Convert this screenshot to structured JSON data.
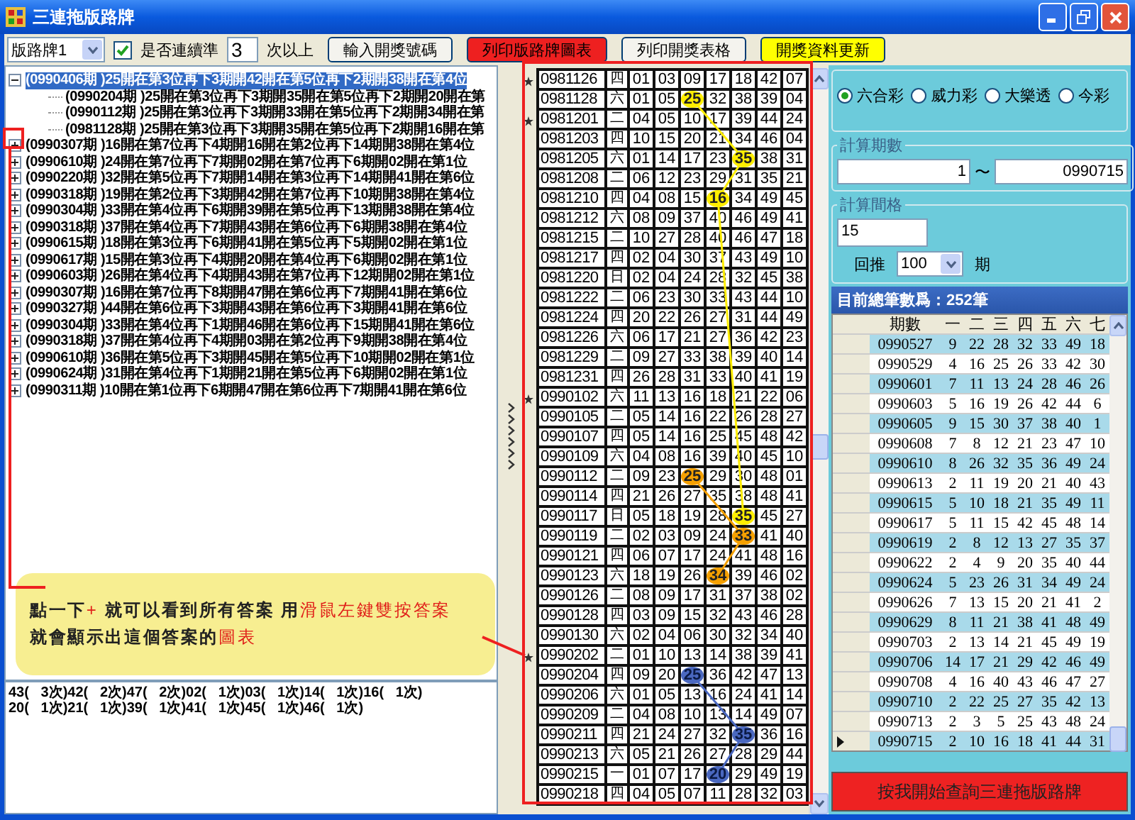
{
  "window": {
    "title": "三連拖版路牌"
  },
  "toolbar": {
    "board_select": {
      "value": "版路牌1"
    },
    "consecutive": {
      "label": "是否連續準",
      "checked": true
    },
    "count_field": {
      "value": "3"
    },
    "count_suffix": "次以上",
    "buttons": [
      {
        "label": "輸入開獎號碼",
        "color": "#f4f3ee"
      },
      {
        "label": "列印版路牌圖表",
        "color": "#ee2020"
      },
      {
        "label": "列印開獎表格",
        "color": "#f4f3ee"
      },
      {
        "label": "開獎資料更新",
        "color": "#ffff00"
      }
    ]
  },
  "tree": [
    {
      "label": "(0990406期 )25開在第3位再下3期開42開在第5位再下2期開38開在第4位",
      "expanded": true,
      "selected": true,
      "children": [
        {
          "label": "(0990204期 )25開在第3位再下3期開35開在第5位再下2期開20開在第",
          "selected": false
        },
        {
          "label": "(0990112期 )25開在第3位再下3期開33開在第5位再下2期開34開在第",
          "selected": false
        },
        {
          "label": "(0981128期 )25開在第3位再下3期開35開在第5位再下2期開16開在第",
          "selected": false
        }
      ]
    },
    {
      "label": "(0990307期 )16開在第7位再下4期開16開在第2位再下14期開38開在第4位",
      "expanded": false,
      "selected": false
    },
    {
      "label": "(0990610期 )24開在第7位再下7期開02開在第7位再下6期開02開在第1位",
      "expanded": false,
      "selected": false
    },
    {
      "label": "(0990220期 )32開在第5位再下7期開14開在第3位再下14期開41開在第6位",
      "expanded": false,
      "selected": false
    },
    {
      "label": "(0990318期 )19開在第2位再下3期開42開在第7位再下10期開38開在第4位",
      "expanded": false,
      "selected": false
    },
    {
      "label": "(0990304期 )33開在第4位再下6期開39開在第5位再下13期開38開在第4位",
      "expanded": false,
      "selected": false
    },
    {
      "label": "(0990318期 )37開在第4位再下7期開43開在第6位再下6期開38開在第4位",
      "expanded": false,
      "selected": false
    },
    {
      "label": "(0990615期 )18開在第3位再下6期開41開在第5位再下5期開02開在第1位",
      "expanded": false,
      "selected": false
    },
    {
      "label": "(0990617期 )15開在第3位再下4期開20開在第4位再下6期開02開在第1位",
      "expanded": false,
      "selected": false
    },
    {
      "label": "(0990603期 )26開在第4位再下4期開43開在第7位再下12期開02開在第1位",
      "expanded": false,
      "selected": false
    },
    {
      "label": "(0990307期 )16開在第7位再下8期開47開在第6位再下7期開41開在第6位",
      "expanded": false,
      "selected": false
    },
    {
      "label": "(0990327期 )44開在第6位再下3期開43開在第6位再下3期開41開在第6位",
      "expanded": false,
      "selected": false
    },
    {
      "label": "(0990304期 )33開在第4位再下1期開46開在第6位再下15期開41開在第6位",
      "expanded": false,
      "selected": false
    },
    {
      "label": "(0990318期 )37開在第4位再下4期開03開在第2位再下9期開38開在第4位",
      "expanded": false,
      "selected": false
    },
    {
      "label": "(0990610期 )36開在第5位再下3期開45開在第5位再下10期開02開在第1位",
      "expanded": false,
      "selected": false
    },
    {
      "label": "(0990624期 )31開在第4位再下1期開21開在第5位再下6期開02開在第1位",
      "expanded": false,
      "selected": false
    },
    {
      "label": "(0990311期 )10開在第1位再下6期開47開在第6位再下7期開41開在第6位",
      "expanded": false,
      "selected": false
    }
  ],
  "callout": {
    "lines": [
      [
        {
          "text": "點一下",
          "highlight": false
        },
        {
          "text": "+",
          "highlight": true
        },
        {
          "text": " 就可以看到所有答案 用",
          "highlight": false
        },
        {
          "text": "滑鼠左鍵雙按答案",
          "highlight": true
        }
      ],
      [
        {
          "text": "就會顯示出這個答案的",
          "highlight": false
        },
        {
          "text": "圖表",
          "highlight": true
        }
      ]
    ]
  },
  "results": {
    "lines": [
      "43(   3次)42(   2次)47(   2次)02(   1次)03(   1次)14(   1次)16(   1次)",
      "20(   1次)21(   1次)39(   1次)41(   1次)45(   1次)46(   1次)"
    ]
  },
  "draw_table": {
    "rows": [
      {
        "date": "0981126",
        "weekday": "四",
        "starred": true,
        "numbers": [
          "01",
          "03",
          "09",
          "17",
          "18",
          "42",
          "07"
        ]
      },
      {
        "date": "0981128",
        "weekday": "六",
        "starred": false,
        "numbers": [
          "01",
          "05",
          {
            "value": "25",
            "color": "#ffee00"
          },
          "32",
          "38",
          "39",
          "04"
        ]
      },
      {
        "date": "0981201",
        "weekday": "二",
        "starred": true,
        "numbers": [
          "04",
          "05",
          "10",
          "17",
          "39",
          "44",
          "24"
        ]
      },
      {
        "date": "0981203",
        "weekday": "四",
        "starred": false,
        "numbers": [
          "10",
          "15",
          "20",
          "21",
          "34",
          "46",
          "04"
        ]
      },
      {
        "date": "0981205",
        "weekday": "六",
        "starred": false,
        "numbers": [
          "01",
          "14",
          "17",
          "23",
          {
            "value": "35",
            "color": "#ffee00"
          },
          "38",
          "31"
        ]
      },
      {
        "date": "0981208",
        "weekday": "二",
        "starred": false,
        "numbers": [
          "06",
          "12",
          "23",
          "29",
          "31",
          "35",
          "21"
        ]
      },
      {
        "date": "0981210",
        "weekday": "四",
        "starred": false,
        "numbers": [
          "04",
          "08",
          "15",
          {
            "value": "16",
            "color": "#ffee00"
          },
          "34",
          "49",
          "45"
        ]
      },
      {
        "date": "0981212",
        "weekday": "六",
        "starred": false,
        "numbers": [
          "08",
          "09",
          "37",
          "40",
          "46",
          "49",
          "41"
        ]
      },
      {
        "date": "0981215",
        "weekday": "二",
        "starred": false,
        "numbers": [
          "10",
          "27",
          "28",
          "40",
          "46",
          "47",
          "18"
        ]
      },
      {
        "date": "0981217",
        "weekday": "四",
        "starred": false,
        "numbers": [
          "02",
          "04",
          "30",
          "37",
          "43",
          "49",
          "10"
        ]
      },
      {
        "date": "0981220",
        "weekday": "日",
        "starred": false,
        "numbers": [
          "02",
          "04",
          "24",
          "28",
          "32",
          "45",
          "38"
        ]
      },
      {
        "date": "0981222",
        "weekday": "二",
        "starred": false,
        "numbers": [
          "06",
          "23",
          "30",
          "33",
          "43",
          "44",
          "10"
        ]
      },
      {
        "date": "0981224",
        "weekday": "四",
        "starred": false,
        "numbers": [
          "20",
          "22",
          "26",
          "27",
          "31",
          "44",
          "49"
        ]
      },
      {
        "date": "0981226",
        "weekday": "六",
        "starred": false,
        "numbers": [
          "06",
          "17",
          "21",
          "27",
          "36",
          "42",
          "23"
        ]
      },
      {
        "date": "0981229",
        "weekday": "二",
        "starred": false,
        "numbers": [
          "09",
          "27",
          "33",
          "38",
          "39",
          "40",
          "14"
        ]
      },
      {
        "date": "0981231",
        "weekday": "四",
        "starred": false,
        "numbers": [
          "26",
          "28",
          "31",
          "33",
          "40",
          "41",
          "19"
        ]
      },
      {
        "date": "0990102",
        "weekday": "六",
        "starred": true,
        "numbers": [
          "11",
          "13",
          "16",
          "18",
          "21",
          "22",
          "06"
        ]
      },
      {
        "date": "0990105",
        "weekday": "二",
        "starred": false,
        "numbers": [
          "05",
          "14",
          "16",
          "22",
          "26",
          "28",
          "27"
        ]
      },
      {
        "date": "0990107",
        "weekday": "四",
        "starred": false,
        "numbers": [
          "05",
          "14",
          "16",
          "25",
          "45",
          "48",
          "42"
        ]
      },
      {
        "date": "0990109",
        "weekday": "六",
        "starred": false,
        "numbers": [
          "04",
          "08",
          "16",
          "39",
          "40",
          "45",
          "10"
        ]
      },
      {
        "date": "0990112",
        "weekday": "二",
        "starred": false,
        "numbers": [
          "09",
          "23",
          {
            "value": "25",
            "color": "#f5a000"
          },
          "29",
          "30",
          "48",
          "01"
        ]
      },
      {
        "date": "0990114",
        "weekday": "四",
        "starred": false,
        "numbers": [
          "21",
          "26",
          "27",
          "35",
          "38",
          "48",
          "41"
        ]
      },
      {
        "date": "0990117",
        "weekday": "日",
        "starred": false,
        "numbers": [
          "05",
          "18",
          "19",
          "28",
          {
            "value": "35",
            "color": "#ffee00"
          },
          "45",
          "27"
        ]
      },
      {
        "date": "0990119",
        "weekday": "二",
        "starred": false,
        "numbers": [
          "02",
          "03",
          "09",
          "24",
          {
            "value": "33",
            "color": "#f5a000"
          },
          "41",
          "40"
        ]
      },
      {
        "date": "0990121",
        "weekday": "四",
        "starred": false,
        "numbers": [
          "06",
          "07",
          "17",
          "24",
          "41",
          "48",
          "16"
        ]
      },
      {
        "date": "0990123",
        "weekday": "六",
        "starred": false,
        "numbers": [
          "18",
          "19",
          "26",
          {
            "value": "34",
            "color": "#f5a000"
          },
          "39",
          "46",
          "02"
        ]
      },
      {
        "date": "0990126",
        "weekday": "二",
        "starred": false,
        "numbers": [
          "08",
          "09",
          "17",
          "31",
          "37",
          "38",
          "02"
        ]
      },
      {
        "date": "0990128",
        "weekday": "四",
        "starred": false,
        "numbers": [
          "03",
          "09",
          "15",
          "32",
          "43",
          "46",
          "28"
        ]
      },
      {
        "date": "0990130",
        "weekday": "六",
        "starred": false,
        "numbers": [
          "02",
          "04",
          "06",
          "30",
          "32",
          "34",
          "40"
        ]
      },
      {
        "date": "0990202",
        "weekday": "二",
        "starred": true,
        "numbers": [
          "01",
          "10",
          "13",
          "14",
          "38",
          "39",
          "41"
        ]
      },
      {
        "date": "0990204",
        "weekday": "四",
        "starred": false,
        "numbers": [
          "09",
          "20",
          {
            "value": "25",
            "color": "#4a68c0"
          },
          "36",
          "42",
          "47",
          "13"
        ]
      },
      {
        "date": "0990206",
        "weekday": "六",
        "starred": false,
        "numbers": [
          "01",
          "05",
          "13",
          "16",
          "24",
          "41",
          "14"
        ]
      },
      {
        "date": "0990209",
        "weekday": "二",
        "starred": false,
        "numbers": [
          "04",
          "08",
          "10",
          "13",
          "14",
          "49",
          "07"
        ]
      },
      {
        "date": "0990211",
        "weekday": "四",
        "starred": false,
        "numbers": [
          "21",
          "24",
          "27",
          "32",
          {
            "value": "35",
            "color": "#4a68c0"
          },
          "36",
          "16"
        ]
      },
      {
        "date": "0990213",
        "weekday": "六",
        "starred": false,
        "numbers": [
          "05",
          "21",
          "26",
          "27",
          "28",
          "29",
          "44"
        ]
      },
      {
        "date": "0990215",
        "weekday": "一",
        "starred": false,
        "numbers": [
          "01",
          "07",
          "17",
          {
            "value": "20",
            "color": "#4a68c0"
          },
          "29",
          "49",
          "19"
        ]
      },
      {
        "date": "0990218",
        "weekday": "四",
        "starred": false,
        "numbers": [
          "04",
          "05",
          "07",
          "11",
          "28",
          "32",
          "03"
        ]
      }
    ]
  },
  "lottery": {
    "options": [
      {
        "label": "六合彩",
        "selected": true
      },
      {
        "label": "威力彩",
        "selected": false
      },
      {
        "label": "大樂透",
        "selected": false
      },
      {
        "label": "今彩",
        "selected": false
      }
    ]
  },
  "period_range": {
    "title": "計算期數",
    "from": "1",
    "separator": "〜",
    "to": "0990715"
  },
  "interval": {
    "title": "計算間格",
    "value": "15",
    "lookback_label": "回推",
    "lookback_value": "100",
    "unit": "期"
  },
  "history": {
    "caption": "目前總筆數爲：252筆",
    "columns": [
      "期數",
      "一",
      "二",
      "三",
      "四",
      "五",
      "六",
      "七"
    ],
    "rows": [
      {
        "period": "0990527",
        "numbers": [
          "9",
          "22",
          "28",
          "32",
          "33",
          "49",
          "18"
        ],
        "current": false
      },
      {
        "period": "0990529",
        "numbers": [
          "4",
          "16",
          "25",
          "26",
          "33",
          "42",
          "30"
        ],
        "current": false
      },
      {
        "period": "0990601",
        "numbers": [
          "7",
          "11",
          "13",
          "24",
          "28",
          "46",
          "26"
        ],
        "current": false
      },
      {
        "period": "0990603",
        "numbers": [
          "5",
          "16",
          "19",
          "26",
          "42",
          "44",
          "6"
        ],
        "current": false
      },
      {
        "period": "0990605",
        "numbers": [
          "9",
          "15",
          "30",
          "37",
          "38",
          "40",
          "1"
        ],
        "current": false
      },
      {
        "period": "0990608",
        "numbers": [
          "7",
          "8",
          "12",
          "21",
          "23",
          "47",
          "10"
        ],
        "current": false
      },
      {
        "period": "0990610",
        "numbers": [
          "8",
          "26",
          "32",
          "35",
          "36",
          "49",
          "24"
        ],
        "current": false
      },
      {
        "period": "0990613",
        "numbers": [
          "2",
          "11",
          "19",
          "20",
          "21",
          "40",
          "43"
        ],
        "current": false
      },
      {
        "period": "0990615",
        "numbers": [
          "5",
          "10",
          "18",
          "21",
          "35",
          "49",
          "11"
        ],
        "current": false
      },
      {
        "period": "0990617",
        "numbers": [
          "5",
          "11",
          "15",
          "42",
          "45",
          "48",
          "14"
        ],
        "current": false
      },
      {
        "period": "0990619",
        "numbers": [
          "2",
          "8",
          "12",
          "13",
          "27",
          "35",
          "37"
        ],
        "current": false
      },
      {
        "period": "0990622",
        "numbers": [
          "2",
          "4",
          "9",
          "20",
          "35",
          "40",
          "44"
        ],
        "current": false
      },
      {
        "period": "0990624",
        "numbers": [
          "5",
          "23",
          "26",
          "31",
          "34",
          "49",
          "24"
        ],
        "current": false
      },
      {
        "period": "0990626",
        "numbers": [
          "7",
          "13",
          "15",
          "20",
          "21",
          "41",
          "2"
        ],
        "current": false
      },
      {
        "period": "0990629",
        "numbers": [
          "8",
          "11",
          "21",
          "38",
          "41",
          "48",
          "49"
        ],
        "current": false
      },
      {
        "period": "0990703",
        "numbers": [
          "2",
          "13",
          "14",
          "21",
          "45",
          "49",
          "19"
        ],
        "current": false
      },
      {
        "period": "0990706",
        "numbers": [
          "14",
          "17",
          "21",
          "29",
          "42",
          "46",
          "49"
        ],
        "current": false
      },
      {
        "period": "0990708",
        "numbers": [
          "4",
          "16",
          "40",
          "43",
          "46",
          "47",
          "27"
        ],
        "current": false
      },
      {
        "period": "0990710",
        "numbers": [
          "2",
          "22",
          "25",
          "27",
          "35",
          "42",
          "13"
        ],
        "current": false
      },
      {
        "period": "0990713",
        "numbers": [
          "2",
          "3",
          "5",
          "25",
          "43",
          "48",
          "24"
        ],
        "current": false
      },
      {
        "period": "0990715",
        "numbers": [
          "2",
          "10",
          "16",
          "18",
          "41",
          "44",
          "31"
        ],
        "current": true
      }
    ]
  },
  "query_button": {
    "label": "按我開始查詢三連拖版路牌"
  }
}
